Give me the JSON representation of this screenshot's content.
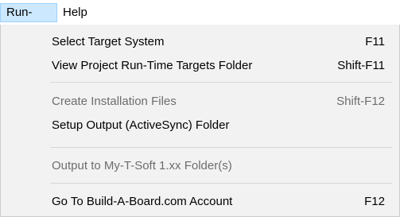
{
  "menubar": {
    "items": [
      {
        "label": "Run-Time",
        "active": true
      },
      {
        "label": "Help",
        "active": false
      }
    ]
  },
  "dropdown": {
    "items": [
      {
        "label": "Select Target System",
        "shortcut": "F11",
        "enabled": true
      },
      {
        "label": "View Project Run-Time Targets Folder",
        "shortcut": "Shift-F11",
        "enabled": true
      },
      {
        "label": "Create Installation Files",
        "shortcut": "Shift-F12",
        "enabled": false
      },
      {
        "label": "Setup Output (ActiveSync) Folder",
        "shortcut": "",
        "enabled": true
      },
      {
        "label": "Output to My-T-Soft 1.xx Folder(s)",
        "shortcut": "",
        "enabled": false
      },
      {
        "label": "Go To Build-A-Board.com Account",
        "shortcut": "F12",
        "enabled": true
      }
    ]
  },
  "colors": {
    "active_menu_bg": "#cce8ff",
    "active_menu_border": "#99d1ff",
    "dropdown_bg": "#f2f2f2",
    "disabled_text": "#6d6d6d"
  }
}
